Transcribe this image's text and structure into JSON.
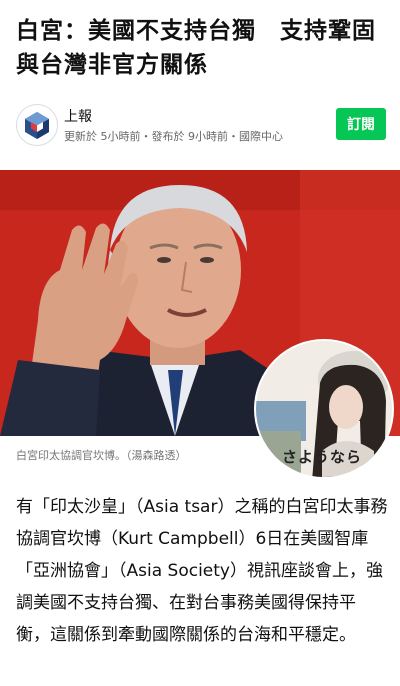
{
  "article": {
    "headline": "白宮：美國不支持台獨　支持鞏固\n與台灣非官方關係",
    "caption": "白宮印太協調官坎博。（湯森路透）",
    "body": "有「印太沙皇」（Asia tsar）之稱的白宮印太事務協調官坎博（Kurt Campbell）6日在美國智庫「亞洲協會」（Asia Society）視訊座談會上，強調美國不支持台獨、在對台事務美國得保持平衡，這關係到牽動國際關係的台海和平穩定。"
  },
  "publisher": {
    "name": "上報",
    "meta": "更新於 5小時前・發布於 9小時前・國際中心",
    "subscribe_label": "訂閱",
    "logo_icon": "publisher-cube-logo"
  },
  "overlay": {
    "text": "さようなら"
  },
  "colors": {
    "subscribe": "#06c755",
    "photo_background": "#c8281e"
  }
}
